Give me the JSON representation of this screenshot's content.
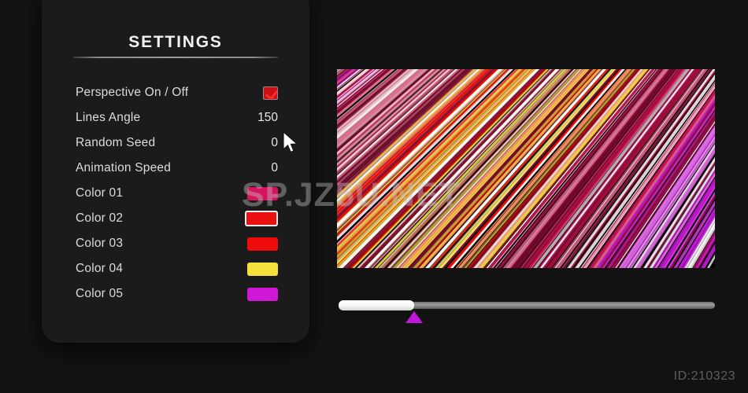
{
  "panel": {
    "title": "SETTINGS",
    "parameters": [
      {
        "label": "Perspective On / Off",
        "value": "",
        "widget": "checkbox",
        "checked": true
      },
      {
        "label": "Lines Angle",
        "value": "150",
        "widget": "number"
      },
      {
        "label": "Random Seed",
        "value": "0",
        "widget": "number"
      },
      {
        "label": "Animation Speed",
        "value": "0",
        "widget": "number"
      }
    ],
    "colors": [
      {
        "label": "Color 01",
        "hex": "#d6135e",
        "selected": false
      },
      {
        "label": "Color 02",
        "hex": "#ec1111",
        "selected": true
      },
      {
        "label": "Color 03",
        "hex": "#ee0c0c",
        "selected": false
      },
      {
        "label": "Color 04",
        "hex": "#f4e23c",
        "selected": false
      },
      {
        "label": "Color 05",
        "hex": "#cf18d6",
        "selected": false
      }
    ]
  },
  "canvas": {
    "name": "generative-lines-artwork",
    "background": "#050505",
    "line_angle": 150,
    "palette": [
      "#d6135e",
      "#ec1111",
      "#ee0c0c",
      "#f4e23c",
      "#cf18d6",
      "#ffffff",
      "#6b0a28"
    ]
  },
  "timeline": {
    "progress_percent": 20,
    "playhead_percent": 20,
    "fill_color": "#ffffff",
    "playhead_color": "#c018d8"
  },
  "watermark": {
    "text": "SP.JZ5U.NET"
  },
  "footer": {
    "id_label": "ID:210323"
  },
  "cursor": {
    "name": "arrow-pointer"
  }
}
